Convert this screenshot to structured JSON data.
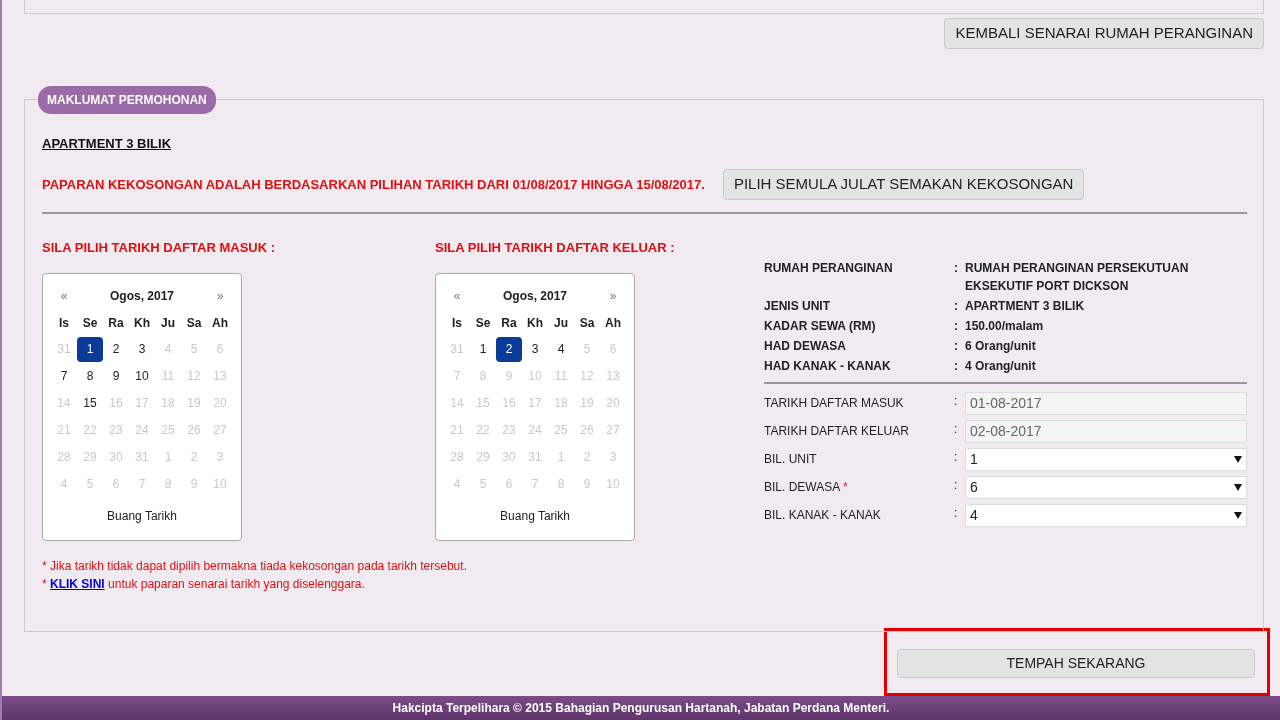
{
  "top_button": "KEMBALI SENARAI RUMAH PERANGINAN",
  "section": {
    "legend": "MAKLUMAT PERMOHONAN",
    "unit_title": "APARTMENT 3 BILIK",
    "notice": "PAPARAN KEKOSONGAN ADALAH BERDASARKAN PILIHAN TARIKH DARI 01/08/2017 HINGGA 15/08/2017.",
    "reselect_button": "PILIH SEMULA JULAT SEMAKAN KEKOSONGAN"
  },
  "calendars": [
    {
      "heading": "SILA PILIH TARIKH DAFTAR MASUK :",
      "prev": "«",
      "month": "Ogos, 2017",
      "next": "»",
      "weekdays": [
        "Is",
        "Se",
        "Ra",
        "Kh",
        "Ju",
        "Sa",
        "Ah"
      ],
      "clear": "Buang Tarikh",
      "weeks": [
        [
          {
            "day": "31",
            "enabled": false,
            "selected": false
          },
          {
            "day": "1",
            "enabled": true,
            "selected": true
          },
          {
            "day": "2",
            "enabled": true,
            "selected": false
          },
          {
            "day": "3",
            "enabled": true,
            "selected": false
          },
          {
            "day": "4",
            "enabled": false,
            "selected": false
          },
          {
            "day": "5",
            "enabled": false,
            "selected": false
          },
          {
            "day": "6",
            "enabled": false,
            "selected": false
          }
        ],
        [
          {
            "day": "7",
            "enabled": true,
            "selected": false
          },
          {
            "day": "8",
            "enabled": true,
            "selected": false
          },
          {
            "day": "9",
            "enabled": true,
            "selected": false
          },
          {
            "day": "10",
            "enabled": true,
            "selected": false
          },
          {
            "day": "11",
            "enabled": false,
            "selected": false
          },
          {
            "day": "12",
            "enabled": false,
            "selected": false
          },
          {
            "day": "13",
            "enabled": false,
            "selected": false
          }
        ],
        [
          {
            "day": "14",
            "enabled": false,
            "selected": false
          },
          {
            "day": "15",
            "enabled": true,
            "selected": false
          },
          {
            "day": "16",
            "enabled": false,
            "selected": false
          },
          {
            "day": "17",
            "enabled": false,
            "selected": false
          },
          {
            "day": "18",
            "enabled": false,
            "selected": false
          },
          {
            "day": "19",
            "enabled": false,
            "selected": false
          },
          {
            "day": "20",
            "enabled": false,
            "selected": false
          }
        ],
        [
          {
            "day": "21",
            "enabled": false,
            "selected": false
          },
          {
            "day": "22",
            "enabled": false,
            "selected": false
          },
          {
            "day": "23",
            "enabled": false,
            "selected": false
          },
          {
            "day": "24",
            "enabled": false,
            "selected": false
          },
          {
            "day": "25",
            "enabled": false,
            "selected": false
          },
          {
            "day": "26",
            "enabled": false,
            "selected": false
          },
          {
            "day": "27",
            "enabled": false,
            "selected": false
          }
        ],
        [
          {
            "day": "28",
            "enabled": false,
            "selected": false
          },
          {
            "day": "29",
            "enabled": false,
            "selected": false
          },
          {
            "day": "30",
            "enabled": false,
            "selected": false
          },
          {
            "day": "31",
            "enabled": false,
            "selected": false
          },
          {
            "day": "1",
            "enabled": false,
            "selected": false
          },
          {
            "day": "2",
            "enabled": false,
            "selected": false
          },
          {
            "day": "3",
            "enabled": false,
            "selected": false
          }
        ],
        [
          {
            "day": "4",
            "enabled": false,
            "selected": false
          },
          {
            "day": "5",
            "enabled": false,
            "selected": false
          },
          {
            "day": "6",
            "enabled": false,
            "selected": false
          },
          {
            "day": "7",
            "enabled": false,
            "selected": false
          },
          {
            "day": "8",
            "enabled": false,
            "selected": false
          },
          {
            "day": "9",
            "enabled": false,
            "selected": false
          },
          {
            "day": "10",
            "enabled": false,
            "selected": false
          }
        ]
      ]
    },
    {
      "heading": "SILA PILIH TARIKH DAFTAR KELUAR :",
      "prev": "«",
      "month": "Ogos, 2017",
      "next": "»",
      "weekdays": [
        "Is",
        "Se",
        "Ra",
        "Kh",
        "Ju",
        "Sa",
        "Ah"
      ],
      "clear": "Buang Tarikh",
      "weeks": [
        [
          {
            "day": "31",
            "enabled": false,
            "selected": false
          },
          {
            "day": "1",
            "enabled": true,
            "selected": false
          },
          {
            "day": "2",
            "enabled": true,
            "selected": true
          },
          {
            "day": "3",
            "enabled": true,
            "selected": false
          },
          {
            "day": "4",
            "enabled": true,
            "selected": false
          },
          {
            "day": "5",
            "enabled": false,
            "selected": false
          },
          {
            "day": "6",
            "enabled": false,
            "selected": false
          }
        ],
        [
          {
            "day": "7",
            "enabled": false,
            "selected": false
          },
          {
            "day": "8",
            "enabled": false,
            "selected": false
          },
          {
            "day": "9",
            "enabled": false,
            "selected": false
          },
          {
            "day": "10",
            "enabled": false,
            "selected": false
          },
          {
            "day": "11",
            "enabled": false,
            "selected": false
          },
          {
            "day": "12",
            "enabled": false,
            "selected": false
          },
          {
            "day": "13",
            "enabled": false,
            "selected": false
          }
        ],
        [
          {
            "day": "14",
            "enabled": false,
            "selected": false
          },
          {
            "day": "15",
            "enabled": false,
            "selected": false
          },
          {
            "day": "16",
            "enabled": false,
            "selected": false
          },
          {
            "day": "17",
            "enabled": false,
            "selected": false
          },
          {
            "day": "18",
            "enabled": false,
            "selected": false
          },
          {
            "day": "19",
            "enabled": false,
            "selected": false
          },
          {
            "day": "20",
            "enabled": false,
            "selected": false
          }
        ],
        [
          {
            "day": "21",
            "enabled": false,
            "selected": false
          },
          {
            "day": "22",
            "enabled": false,
            "selected": false
          },
          {
            "day": "23",
            "enabled": false,
            "selected": false
          },
          {
            "day": "24",
            "enabled": false,
            "selected": false
          },
          {
            "day": "25",
            "enabled": false,
            "selected": false
          },
          {
            "day": "26",
            "enabled": false,
            "selected": false
          },
          {
            "day": "27",
            "enabled": false,
            "selected": false
          }
        ],
        [
          {
            "day": "28",
            "enabled": false,
            "selected": false
          },
          {
            "day": "29",
            "enabled": false,
            "selected": false
          },
          {
            "day": "30",
            "enabled": false,
            "selected": false
          },
          {
            "day": "31",
            "enabled": false,
            "selected": false
          },
          {
            "day": "1",
            "enabled": false,
            "selected": false
          },
          {
            "day": "2",
            "enabled": false,
            "selected": false
          },
          {
            "day": "3",
            "enabled": false,
            "selected": false
          }
        ],
        [
          {
            "day": "4",
            "enabled": false,
            "selected": false
          },
          {
            "day": "5",
            "enabled": false,
            "selected": false
          },
          {
            "day": "6",
            "enabled": false,
            "selected": false
          },
          {
            "day": "7",
            "enabled": false,
            "selected": false
          },
          {
            "day": "8",
            "enabled": false,
            "selected": false
          },
          {
            "day": "9",
            "enabled": false,
            "selected": false
          },
          {
            "day": "10",
            "enabled": false,
            "selected": false
          }
        ]
      ]
    }
  ],
  "notes": [
    {
      "star": "*",
      "text": "Jika tarikh tidak dapat dipilih bermakna tiada kekosongan pada tarikh tersebut."
    },
    {
      "star": "*",
      "link": "KLIK SINI",
      "text": "untuk paparan senarai tarikh yang diselenggara."
    }
  ],
  "summary": [
    {
      "label": "RUMAH PERANGINAN",
      "colon": ":",
      "value": "RUMAH PERANGINAN PERSEKUTUAN EKSEKUTIF PORT DICKSON"
    },
    {
      "label": "JENIS UNIT",
      "colon": ":",
      "value": "APARTMENT 3 BILIK"
    },
    {
      "label": "KADAR SEWA (RM)",
      "colon": ":",
      "value": "150.00/malam"
    },
    {
      "label": "HAD DEWASA",
      "colon": ":",
      "value": "6 Orang/unit"
    },
    {
      "label": "HAD KANAK - KANAK",
      "colon": ":",
      "value": "4 Orang/unit"
    }
  ],
  "form": [
    {
      "kind": "text",
      "label": "TARIKH DAFTAR MASUK",
      "required": false,
      "colon": ":",
      "value": "01-08-2017"
    },
    {
      "kind": "text",
      "label": "TARIKH DAFTAR KELUAR",
      "required": false,
      "colon": ":",
      "value": "02-08-2017"
    },
    {
      "kind": "select",
      "label": "BIL. UNIT",
      "required": false,
      "colon": ":",
      "value": "1"
    },
    {
      "kind": "select",
      "label": "BIL. DEWASA",
      "required": true,
      "colon": ":",
      "value": "6"
    },
    {
      "kind": "select",
      "label": "BIL. KANAK - KANAK",
      "required": false,
      "colon": ":",
      "value": "4"
    }
  ],
  "submit": {
    "label": "TEMPAH SEKARANG",
    "highlighted": true
  },
  "footer": "Hakcipta Terpelihara © 2015 Bahagian Pengurusan Hartanah, Jabatan Perdana Menteri."
}
